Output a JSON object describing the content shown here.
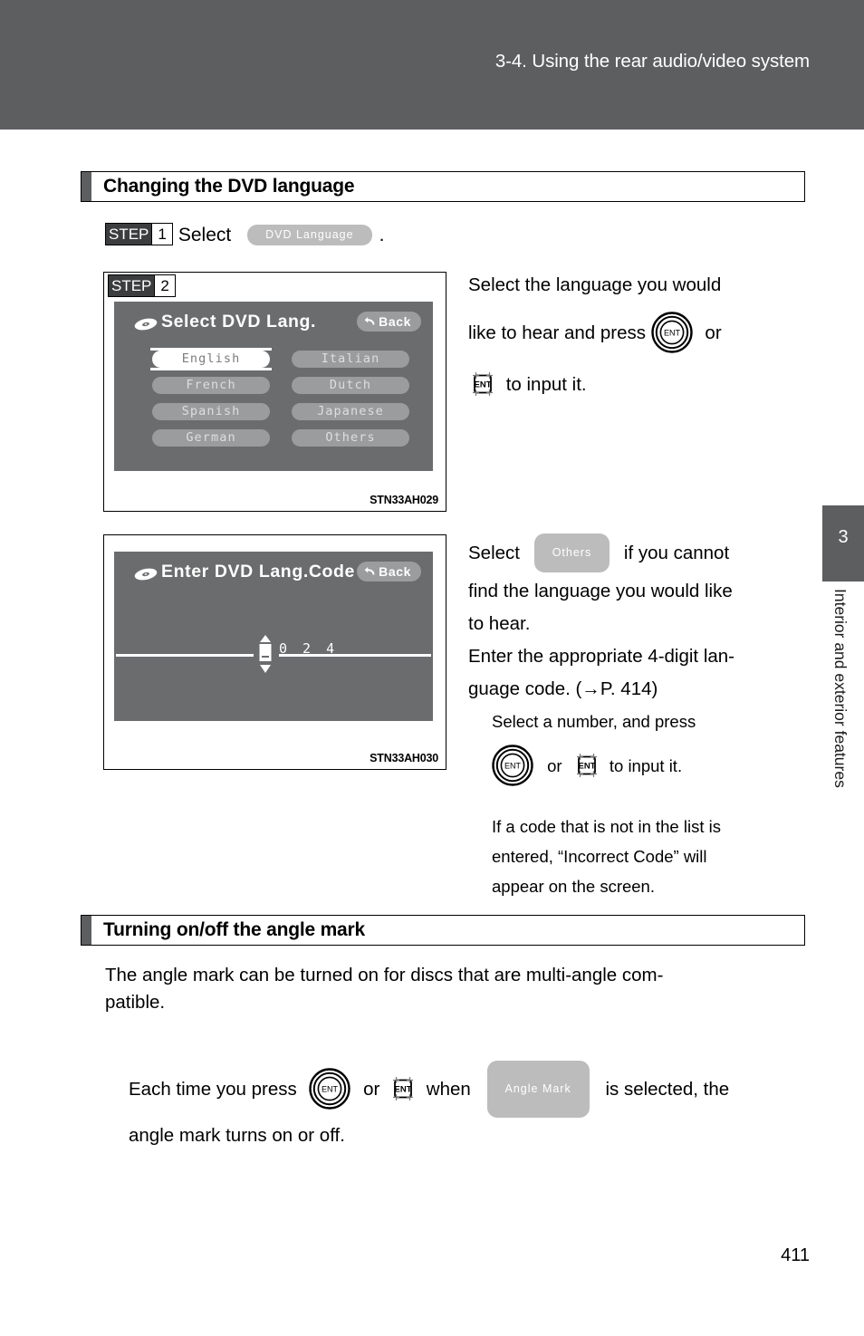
{
  "header": {
    "title": "3-4. Using the rear audio/video system",
    "band_color": "#5c5e60"
  },
  "side_tab": {
    "chapter_number": "3",
    "chapter_label": "Interior and exterior features"
  },
  "sections": {
    "dvd_language": {
      "heading": "Changing the DVD language",
      "step1": {
        "step_word": "STEP",
        "step_number": "1",
        "verb": "Select",
        "pill": "DVD  Language",
        "period": "."
      },
      "step2": {
        "step_word": "STEP",
        "step_number": "2",
        "text_lines": [
          "Select the language you would",
          "like to hear and press",
          "or",
          "to input it."
        ],
        "ent_round_label": "ENT",
        "ent_square_label": "ENT"
      },
      "figure1": {
        "caption": "STN33AH029",
        "screen_title": "Select DVD  Lang.",
        "back_label": "Back",
        "buttons_left": [
          "English",
          "French",
          "Spanish",
          "German"
        ],
        "buttons_right": [
          "Italian",
          "Dutch",
          "Japanese",
          "Others"
        ],
        "selected": "English"
      },
      "figure2": {
        "caption": "STN33AH030",
        "screen_title": "Enter DVD  Lang.Code",
        "back_label": "Back",
        "code_digits": "0 2 4",
        "spinner_placeholder": "_"
      },
      "others_text": {
        "lead": "Select",
        "pill": "Others",
        "lines": [
          "if you cannot",
          "find the language you would like",
          "to hear.",
          "Enter the appropriate 4-digit lan-",
          "guage code. (→P. 414)"
        ]
      },
      "sub_note_1": {
        "lines": [
          "Select a number, and press",
          "or",
          "to input it."
        ],
        "ent_round_label": "ENT",
        "ent_square_label": "ENT"
      },
      "sub_note_2": {
        "lines": [
          "If a code that is not in the list is",
          "entered, “Incorrect Code” will",
          "appear on the screen."
        ]
      }
    },
    "angle_mark": {
      "heading": "Turning on/off the angle mark",
      "intro_lines": [
        "The angle mark can be turned on for discs that are multi-angle com-",
        "patible."
      ],
      "detail": {
        "lead": "Each time you press",
        "mid1": "or",
        "mid2": "when",
        "pill": "Angle Mark",
        "tail": "is selected, the",
        "line2": "angle mark turns on or off.",
        "ent_round_label": "ENT",
        "ent_square_label": "ENT"
      }
    }
  },
  "page_number": "411"
}
